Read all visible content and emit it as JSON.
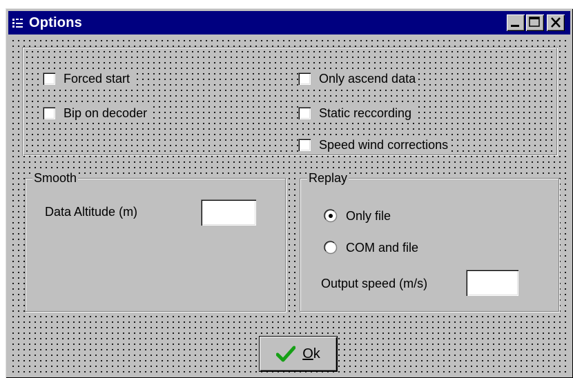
{
  "window": {
    "title": "Options"
  },
  "options": {
    "left": [
      "Forced start",
      "Bip on decoder"
    ],
    "right": [
      "Only ascend data",
      "Static reccording",
      "Speed wind corrections"
    ]
  },
  "smooth": {
    "legend": "Smooth",
    "altitude_label": "Data Altitude (m)",
    "altitude_value": ""
  },
  "replay": {
    "legend": "Replay",
    "options": [
      "Only file",
      "COM and file"
    ],
    "selected": "Only file",
    "output_speed_label": "Output speed (m/s)",
    "output_speed_value": ""
  },
  "ok_button": {
    "mnemonic": "O",
    "rest": "k"
  },
  "colors": {
    "titlebar": "#000080",
    "face": "#c0c0c0",
    "check_icon": "#16a016"
  }
}
